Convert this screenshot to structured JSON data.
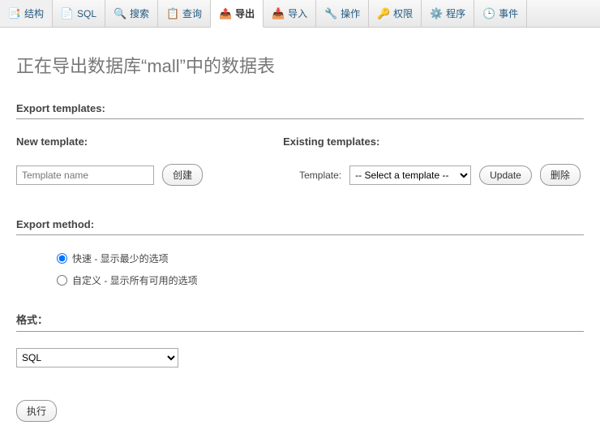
{
  "tabs": [
    {
      "label": "结构",
      "icon": "📑"
    },
    {
      "label": "SQL",
      "icon": "📄"
    },
    {
      "label": "搜索",
      "icon": "🔍"
    },
    {
      "label": "查询",
      "icon": "📋"
    },
    {
      "label": "导出",
      "icon": "📤"
    },
    {
      "label": "导入",
      "icon": "📥"
    },
    {
      "label": "操作",
      "icon": "🔧"
    },
    {
      "label": "权限",
      "icon": "🔑"
    },
    {
      "label": "程序",
      "icon": "⚙️"
    },
    {
      "label": "事件",
      "icon": "🕒"
    }
  ],
  "page_title": "正在导出数据库“mall”中的数据表",
  "sections": {
    "export_templates": "Export templates:",
    "new_template": "New template:",
    "existing_templates": "Existing templates:",
    "export_method": "Export method:",
    "format": "格式："
  },
  "new_template_placeholder": "Template name",
  "template_label": "Template:",
  "template_select_default": "-- Select a template --",
  "buttons": {
    "create": "创建",
    "update": "Update",
    "delete": "删除",
    "execute": "执行"
  },
  "export_methods": {
    "quick": "快速 - 显示最少的选项",
    "custom": "自定义 - 显示所有可用的选项"
  },
  "format_options": {
    "selected": "SQL"
  }
}
